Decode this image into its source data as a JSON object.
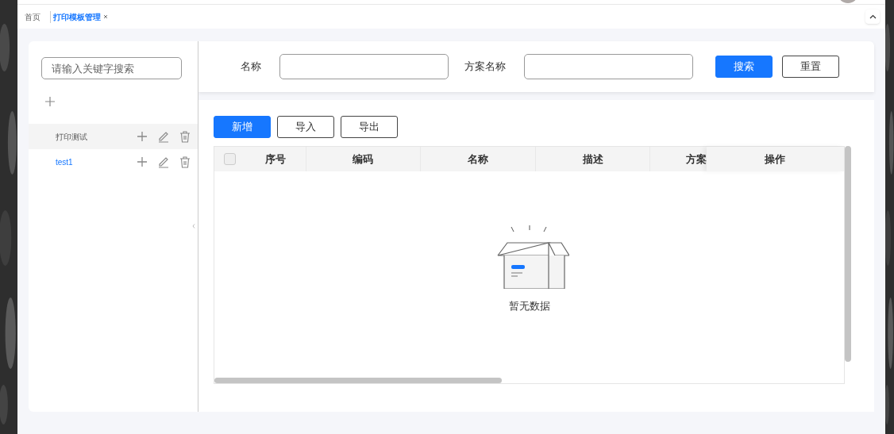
{
  "tabs": [
    {
      "label": "首页",
      "selected": false,
      "closable": false
    },
    {
      "label": "打印模板管理",
      "selected": true,
      "closable": true
    }
  ],
  "sidebar": {
    "search": {
      "placeholder": "请输入关键字搜索"
    },
    "items": [
      {
        "label": "打印测试",
        "selected": true
      },
      {
        "label": "test1",
        "selected": false
      }
    ]
  },
  "filters": [
    {
      "label": "名称"
    },
    {
      "label": "方案名称"
    }
  ],
  "filter_buttons": [
    {
      "label": "搜索",
      "kind": "primary"
    },
    {
      "label": "重置",
      "kind": "default"
    }
  ],
  "toolbar": [
    {
      "label": "新增",
      "kind": "primary"
    },
    {
      "label": "导入",
      "kind": "default"
    },
    {
      "label": "导出",
      "kind": "default"
    }
  ],
  "table": {
    "select_all": false,
    "columns": [
      "序号",
      "编码",
      "名称",
      "描述",
      "方案",
      "操作"
    ],
    "empty_text": "暂无数据"
  }
}
